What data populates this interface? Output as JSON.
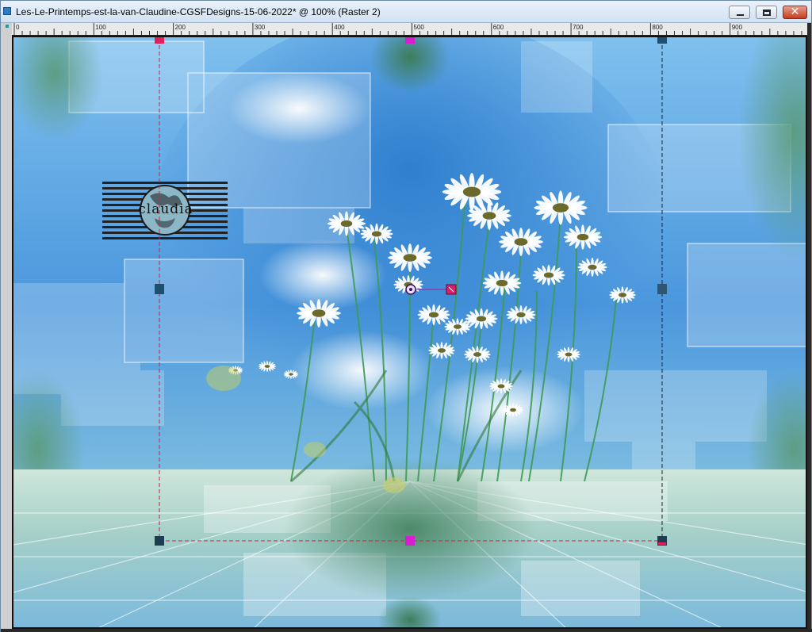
{
  "window": {
    "title": "Les-Le-Printemps-est-la-van-Claudine-CGSFDesigns-15-06-2022* @ 100% (Raster 2)",
    "controls": {
      "minimize_icon": "minimize-icon",
      "maximize_icon": "maximize-icon",
      "close_icon": "close-icon",
      "close_glyph": "✕"
    }
  },
  "ruler": {
    "labels": [
      "0",
      "100",
      "200",
      "300",
      "400",
      "500",
      "600",
      "700",
      "800",
      "900"
    ]
  },
  "canvas": {
    "watermark_text": "claudia",
    "pick_tool": {
      "rotation_handle_icon": "rotation-handle-icon",
      "pivot_icon": "pivot-point-icon"
    }
  },
  "colors": {
    "sky": "#5aa6e0",
    "sky_dark": "#2f7fcf",
    "green": "#4e8f6a",
    "handle_dark": "#1f4f70",
    "handle_magenta": "#d81fd0",
    "guide_red": "#d02040"
  }
}
